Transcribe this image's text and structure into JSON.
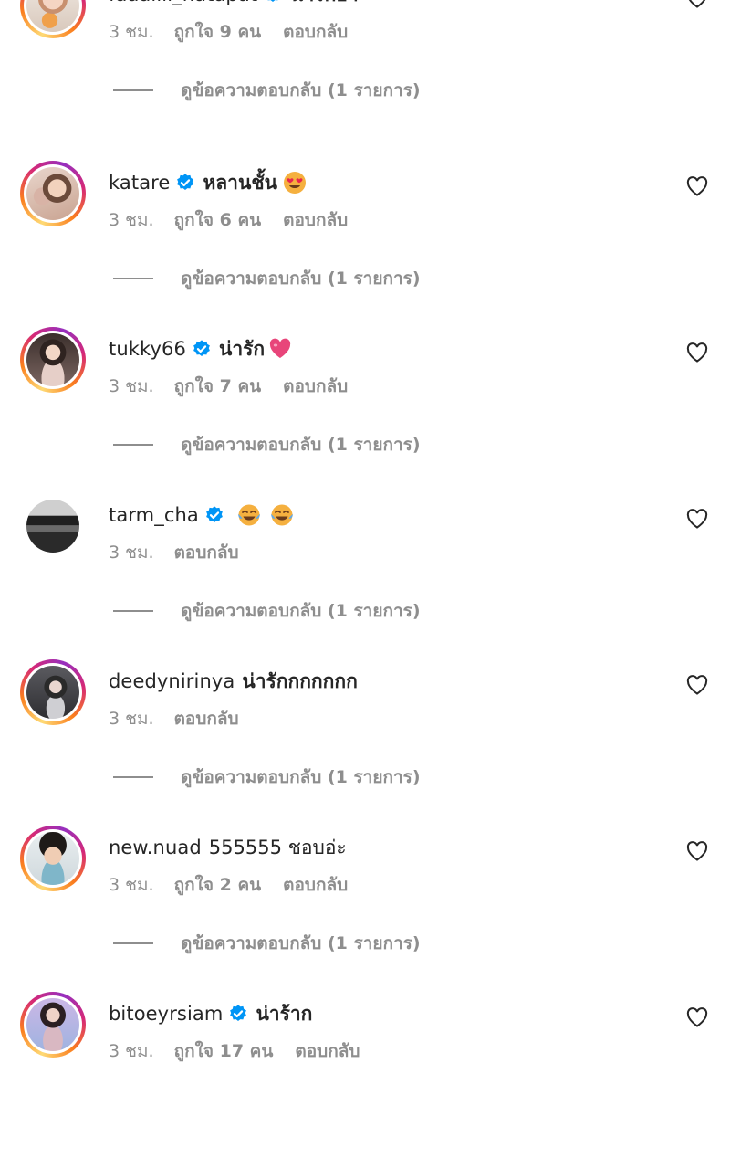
{
  "comments": [
    {
      "username": "faaaiiii_natapat",
      "verified": true,
      "text": "น่ารักอ่า",
      "emoji": [],
      "time": "3 ชม.",
      "likes": "ถูกใจ 9 คน",
      "reply_label": "ตอบกลับ",
      "view_replies": "ดูข้อความตอบกลับ (1 รายการ)",
      "story_ring": true
    },
    {
      "username": "katare",
      "verified": true,
      "text": "หลานชั้น",
      "emoji": [
        "heart-eyes-emoji"
      ],
      "time": "3 ชม.",
      "likes": "ถูกใจ 6 คน",
      "reply_label": "ตอบกลับ",
      "view_replies": "ดูข้อความตอบกลับ (1 รายการ)",
      "story_ring": true
    },
    {
      "username": "tukky66",
      "verified": true,
      "text": "น่ารัก",
      "emoji": [
        "pink-heart-emoji"
      ],
      "time": "3 ชม.",
      "likes": "ถูกใจ 7 คน",
      "reply_label": "ตอบกลับ",
      "view_replies": "ดูข้อความตอบกลับ (1 รายการ)",
      "story_ring": true
    },
    {
      "username": "tarm_cha",
      "verified": true,
      "text": "",
      "emoji": [
        "tears-of-joy-emoji",
        "tears-of-joy-emoji"
      ],
      "time": "3 ชม.",
      "likes": "",
      "reply_label": "ตอบกลับ",
      "view_replies": "ดูข้อความตอบกลับ (1 รายการ)",
      "story_ring": false
    },
    {
      "username": "deedynirinya",
      "verified": false,
      "text": "น่ารักกกกกกก",
      "emoji": [],
      "time": "3 ชม.",
      "likes": "",
      "reply_label": "ตอบกลับ",
      "view_replies": "ดูข้อความตอบกลับ (1 รายการ)",
      "story_ring": true
    },
    {
      "username": "new.nuad",
      "verified": false,
      "text": "555555 ชอบอ่ะ",
      "emoji": [],
      "time": "3 ชม.",
      "likes": "ถูกใจ 2 คน",
      "reply_label": "ตอบกลับ",
      "view_replies": "ดูข้อความตอบกลับ (1 รายการ)",
      "story_ring": true
    },
    {
      "username": "bitoeyrsiam",
      "verified": true,
      "text": "น่าร้าก",
      "emoji": [],
      "time": "3 ชม.",
      "likes": "ถูกใจ 17 คน",
      "reply_label": "ตอบกลับ",
      "view_replies": "",
      "story_ring": true
    }
  ],
  "colors": {
    "text": "#262626",
    "secondary": "#8e8e8e",
    "verified_blue": "#0095f6"
  },
  "icons": {
    "verified": "verified-badge-icon",
    "like": "heart-outline-icon"
  }
}
